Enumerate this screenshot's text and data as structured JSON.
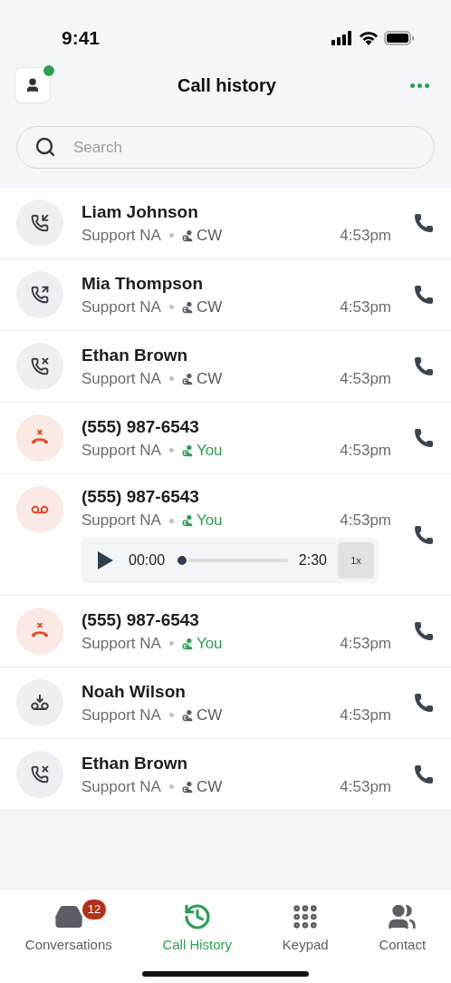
{
  "status_bar": {
    "time": "9:41"
  },
  "header": {
    "title": "Call history",
    "avatar_online": true
  },
  "search": {
    "placeholder": "Search"
  },
  "calls": [
    {
      "kind": "incoming",
      "name": "Liam Johnson",
      "queue": "Support NA",
      "agent": "CW",
      "color": "#555a63",
      "time": "4:53pm"
    },
    {
      "kind": "outgoing",
      "name": "Mia Thompson",
      "queue": "Support NA",
      "agent": "CW",
      "color": "#555a63",
      "time": "4:53pm"
    },
    {
      "kind": "missed",
      "name": "Ethan Brown",
      "queue": "Support NA",
      "agent": "CW",
      "color": "#555a63",
      "time": "4:53pm"
    },
    {
      "kind": "declined",
      "name": "(555) 987-6543",
      "queue": "Support NA",
      "agent": "You",
      "color": "#2e9e55",
      "time": "4:53pm"
    },
    {
      "kind": "voicemail",
      "name": "(555) 987-6543",
      "queue": "Support NA",
      "agent": "You",
      "color": "#2e9e55",
      "time": "4:53pm",
      "player": {
        "position": "00:00",
        "duration": "2:30",
        "speed": "1x",
        "level": 0
      }
    },
    {
      "kind": "declined",
      "name": "(555) 987-6543",
      "queue": "Support NA",
      "agent": "You",
      "color": "#2e9e55",
      "time": "4:53pm"
    },
    {
      "kind": "voicemail-saved",
      "name": "Noah Wilson",
      "queue": "Support NA",
      "agent": "CW",
      "color": "#555a63",
      "time": "4:53pm"
    },
    {
      "kind": "missed",
      "name": "Ethan Brown",
      "queue": "Support NA",
      "agent": "CW",
      "color": "#555a63",
      "time": "4:53pm"
    }
  ],
  "tabs": [
    {
      "kind": "conversations",
      "label": "Conversations",
      "badge": "12",
      "selected": false
    },
    {
      "kind": "history",
      "label": "Call History",
      "selected": true
    },
    {
      "kind": "keypad",
      "label": "Keypad",
      "selected": false
    },
    {
      "kind": "contacts",
      "label": "Contact",
      "selected": false
    }
  ]
}
